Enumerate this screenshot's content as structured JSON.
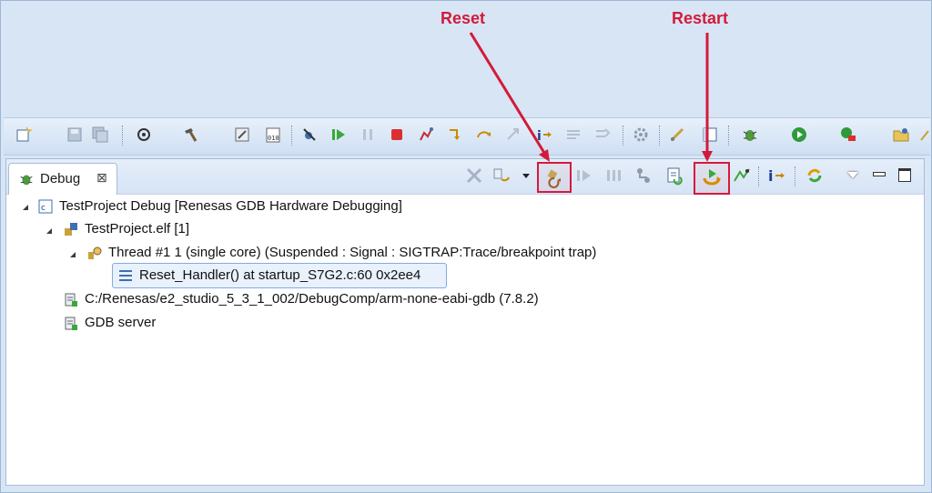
{
  "annotations": {
    "reset": "Reset",
    "restart": "Restart"
  },
  "colors": {
    "annotation": "#d41a3a",
    "background": "#d7e5f5",
    "selection": "#e8f1fc"
  },
  "view": {
    "tab_label": "Debug",
    "tab_close": "⊠",
    "toolbar_icons": [
      "remove-launches-icon",
      "relaunch-icon",
      "reset-icon",
      "resume-icon",
      "suspend-icon",
      "threads-icon",
      "reload-icon",
      "restart-icon",
      "step-filter-icon",
      "instruction-step-icon",
      "refresh-icon",
      "view-menu-icon",
      "minimize-icon",
      "maximize-icon"
    ]
  },
  "tree": {
    "launch": "TestProject Debug [Renesas GDB Hardware Debugging]",
    "elf": "TestProject.elf [1]",
    "thread": "Thread #1 1 (single core) (Suspended : Signal : SIGTRAP:Trace/breakpoint trap)",
    "frame": "Reset_Handler() at startup_S7G2.c:60 0x2ee4",
    "gdb_path": "C:/Renesas/e2_studio_5_3_1_002/DebugComp/arm-none-eabi-gdb (7.8.2)",
    "gdb_server": "GDB server"
  }
}
